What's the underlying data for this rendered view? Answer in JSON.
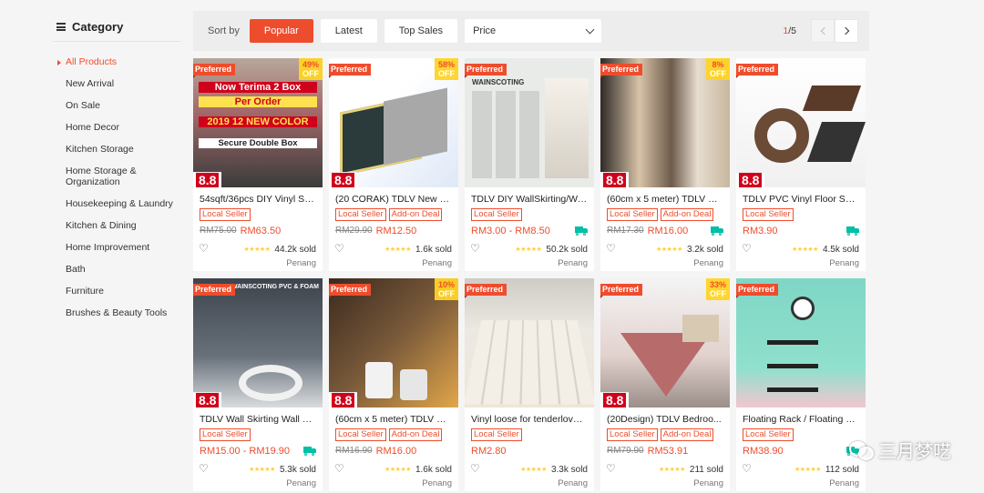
{
  "sidebar": {
    "title": "Category",
    "items": [
      {
        "label": "All Products",
        "active": true
      },
      {
        "label": "New Arrival"
      },
      {
        "label": "On Sale"
      },
      {
        "label": "Home Decor"
      },
      {
        "label": "Kitchen Storage"
      },
      {
        "label": "Home Storage & Organization"
      },
      {
        "label": "Housekeeping & Laundry"
      },
      {
        "label": "Kitchen & Dining"
      },
      {
        "label": "Home Improvement"
      },
      {
        "label": "Bath"
      },
      {
        "label": "Furniture"
      },
      {
        "label": "Brushes & Beauty Tools"
      }
    ]
  },
  "sortbar": {
    "label": "Sort by",
    "popular": "Popular",
    "latest": "Latest",
    "top_sales": "Top Sales",
    "price": "Price",
    "page_current": "1",
    "page_total": "/5"
  },
  "products": [
    {
      "title": "54sqft/36pcs DIY Vinyl Se...",
      "tags": [
        "Local Seller"
      ],
      "old_price": "RM75.00",
      "price": "RM63.50",
      "free_ship": false,
      "sold": "44.2k sold",
      "location": "Penang",
      "preferred": "Preferred",
      "discount": "49%",
      "off": "OFF",
      "badge": "8.8",
      "img_text": [
        "Now Terima 2 Box",
        "Per Order",
        "2019 12 NEW COLOR",
        "Secure Double Box"
      ]
    },
    {
      "title": "(20 CORAK) TDLV New De...",
      "tags": [
        "Local Seller",
        "Add-on Deal"
      ],
      "old_price": "RM29.90",
      "price": "RM12.50",
      "free_ship": false,
      "sold": "1.6k sold",
      "location": "Penang",
      "preferred": "Preferred",
      "discount": "58%",
      "off": "OFF",
      "badge": "8.8"
    },
    {
      "title": "TDLV DIY WallSkirting/Wa...",
      "tags": [
        "Local Seller"
      ],
      "old_price": "",
      "price": "RM3.00 - RM8.50",
      "free_ship": true,
      "sold": "50.2k sold",
      "location": "Penang",
      "preferred": "Preferred",
      "discount": "",
      "badge": "",
      "img_text": [
        "WAINSCOTING"
      ]
    },
    {
      "title": "(60cm x 5 meter) TDLV DI...",
      "tags": [
        "Local Seller",
        "Add-on Deal"
      ],
      "old_price": "RM17.30",
      "price": "RM16.00",
      "free_ship": true,
      "sold": "3.2k sold",
      "location": "Penang",
      "preferred": "Preferred",
      "discount": "8%",
      "off": "OFF",
      "badge": "8.8"
    },
    {
      "title": "TDLV PVC Vinyl Floor Skir...",
      "tags": [
        "Local Seller"
      ],
      "old_price": "",
      "price": "RM3.90",
      "free_ship": true,
      "sold": "4.5k sold",
      "location": "Penang",
      "preferred": "Preferred",
      "discount": "",
      "badge": "8.8"
    },
    {
      "title": "TDLV Wall Skirting Wall D...",
      "tags": [
        "Local Seller"
      ],
      "old_price": "",
      "price": "RM15.00 - RM19.90",
      "free_ship": true,
      "sold": "5.3k sold",
      "location": "Penang",
      "preferred": "Preferred",
      "discount": "",
      "badge": "8.8",
      "img_text": [
        "WAINSCOTING PVC & FOAM"
      ]
    },
    {
      "title": "(60cm x 5 meter) TDLV DI...",
      "tags": [
        "Local Seller",
        "Add-on Deal"
      ],
      "old_price": "RM16.90",
      "price": "RM16.00",
      "free_ship": false,
      "sold": "1.6k sold",
      "location": "Penang",
      "preferred": "Preferred",
      "discount": "10%",
      "off": "OFF",
      "badge": "8.8"
    },
    {
      "title": "Vinyl loose for tenderlover...",
      "tags": [
        "Local Seller"
      ],
      "old_price": "",
      "price": "RM2.80",
      "free_ship": false,
      "sold": "3.3k sold",
      "location": "Penang",
      "preferred": "Preferred",
      "discount": "",
      "badge": ""
    },
    {
      "title": "(20Design) TDLV Bedroo...",
      "tags": [
        "Local Seller",
        "Add-on Deal"
      ],
      "old_price": "RM79.90",
      "price": "RM53.91",
      "free_ship": false,
      "sold": "211 sold",
      "location": "Penang",
      "preferred": "Preferred",
      "discount": "33%",
      "off": "OFF",
      "badge": "8.8"
    },
    {
      "title": "Floating Rack / Floating S...",
      "tags": [
        "Local Seller"
      ],
      "old_price": "",
      "price": "RM38.90",
      "free_ship": true,
      "sold": "112 sold",
      "location": "Penang",
      "preferred": "Preferred",
      "discount": "",
      "badge": ""
    }
  ],
  "watermark": "三月梦呓",
  "colors": {
    "accent": "#ee4d2d",
    "star": "#ffce3d",
    "ship": "#00bfa5"
  }
}
